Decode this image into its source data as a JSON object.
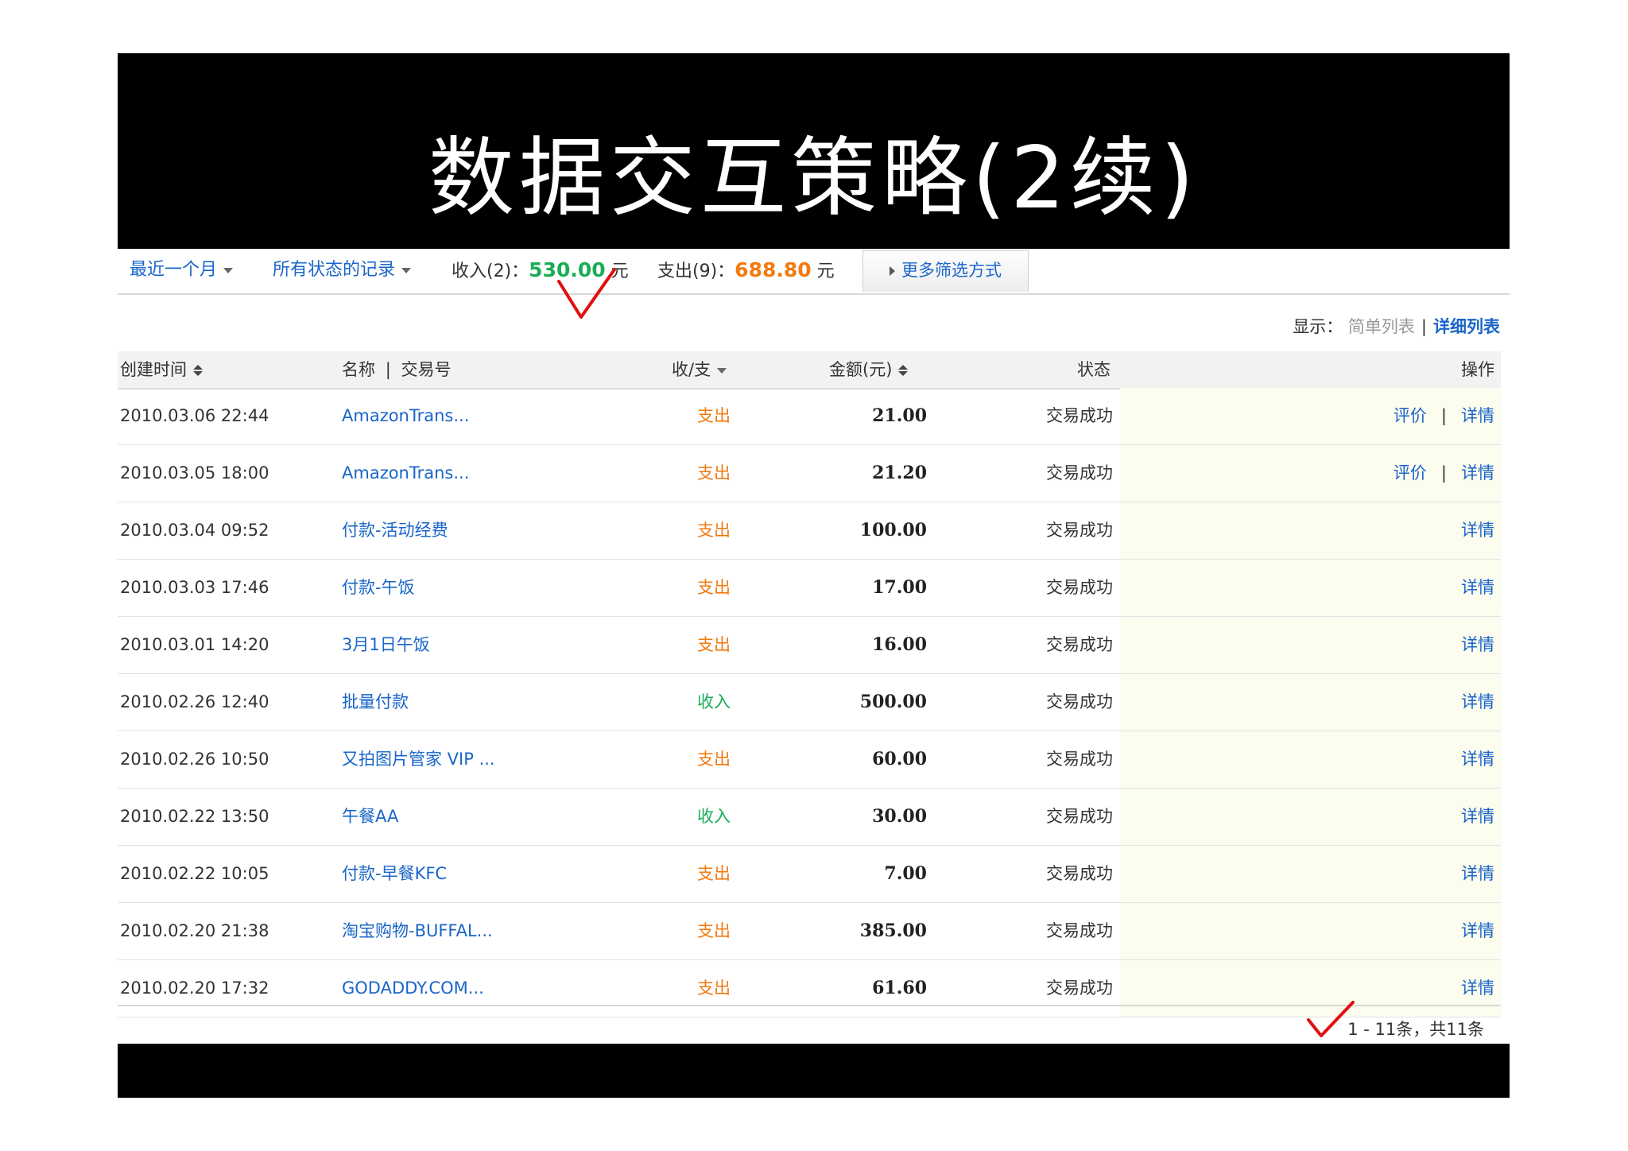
{
  "title": "数据交互策略(2续)",
  "colors": {
    "accent_link": "#1965c9",
    "income": "#1aad55",
    "expense": "#f27a10",
    "title_bg": "#000000",
    "action_bg": "#fcfcef"
  },
  "filters": {
    "period": "最近一个月",
    "status": "所有状态的记录",
    "income_label": "收入(2)：",
    "income_amount": "530.00",
    "expense_label": "支出(9)：",
    "expense_amount": "688.80",
    "currency": "元",
    "more_filters": "更多筛选方式"
  },
  "display": {
    "label": "显示：",
    "simple": "简单列表",
    "separator": "|",
    "detail": "详细列表"
  },
  "table": {
    "headers": {
      "time": "创建时间",
      "name": "名称",
      "sep": "|",
      "trade_no": "交易号",
      "direction": "收/支",
      "amount": "金额(元)",
      "status": "状态",
      "action": "操作"
    },
    "rows": [
      {
        "time": "2010.03.06 22:44",
        "name": "AmazonTrans...",
        "dir": "支出",
        "amount": "21.00",
        "status": "交易成功",
        "rate": "评价",
        "detail": "详情"
      },
      {
        "time": "2010.03.05 18:00",
        "name": "AmazonTrans...",
        "dir": "支出",
        "amount": "21.20",
        "status": "交易成功",
        "rate": "评价",
        "detail": "详情"
      },
      {
        "time": "2010.03.04 09:52",
        "name": "付款-活动经费",
        "dir": "支出",
        "amount": "100.00",
        "status": "交易成功",
        "detail": "详情"
      },
      {
        "time": "2010.03.03 17:46",
        "name": "付款-午饭",
        "dir": "支出",
        "amount": "17.00",
        "status": "交易成功",
        "detail": "详情"
      },
      {
        "time": "2010.03.01 14:20",
        "name": "3月1日午饭",
        "dir": "支出",
        "amount": "16.00",
        "status": "交易成功",
        "detail": "详情"
      },
      {
        "time": "2010.02.26 12:40",
        "name": "批量付款",
        "dir": "收入",
        "amount": "500.00",
        "status": "交易成功",
        "detail": "详情"
      },
      {
        "time": "2010.02.26 10:50",
        "name": "又拍图片管家 VIP ...",
        "dir": "支出",
        "amount": "60.00",
        "status": "交易成功",
        "detail": "详情"
      },
      {
        "time": "2010.02.22 13:50",
        "name": "午餐AA",
        "dir": "收入",
        "amount": "30.00",
        "status": "交易成功",
        "detail": "详情"
      },
      {
        "time": "2010.02.22 10:05",
        "name": "付款-早餐KFC",
        "dir": "支出",
        "amount": "7.00",
        "status": "交易成功",
        "detail": "详情"
      },
      {
        "time": "2010.02.20 21:38",
        "name": "淘宝购物-BUFFAL...",
        "dir": "支出",
        "amount": "385.00",
        "status": "交易成功",
        "detail": "详情"
      },
      {
        "time": "2010.02.20 17:32",
        "name": "GODADDY.COM...",
        "dir": "支出",
        "amount": "61.60",
        "status": "交易成功",
        "detail": "详情"
      }
    ]
  },
  "pager": {
    "text": "1 - 11条，共11条"
  }
}
